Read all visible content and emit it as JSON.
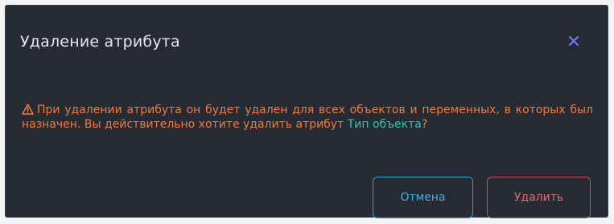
{
  "dialog": {
    "title": "Удаление атрибута",
    "close_icon": "close-icon",
    "warning_icon": "warning-triangle-icon",
    "message_text": "При удалении атрибута он будет удален для всех объектов и переменных, в которых был назначен. Вы действительно хотите удалить атрибут ",
    "attribute_name": "Тип объекта",
    "message_suffix": "?",
    "cancel_label": "Отмена",
    "delete_label": "Удалить"
  },
  "colors": {
    "background": "#252a33",
    "title": "#e6e8ec",
    "warning": "#f07a3e",
    "attribute": "#33c2b3",
    "cancel": "#3fb0e0",
    "delete": "#e46a78",
    "close": "#6b7cff"
  }
}
